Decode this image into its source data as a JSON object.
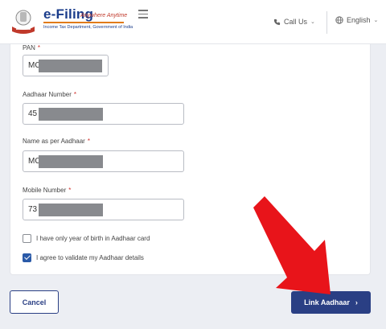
{
  "header": {
    "brand_title": "e-Filing",
    "brand_tagline": "Anywhere Anytime",
    "brand_subtitle": "Income Tax Department, Government of India",
    "call_label": "Call Us",
    "language_label": "English"
  },
  "form": {
    "pan": {
      "label": "PAN",
      "value": "MC"
    },
    "aadhaar": {
      "label": "Aadhaar Number",
      "value": "45"
    },
    "name": {
      "label": "Name as per Aadhaar",
      "value": "MC"
    },
    "mobile": {
      "label": "Mobile Number",
      "value": "73"
    },
    "required_marker": "*",
    "checkbox_year_label": "I have only year of birth in Aadhaar card",
    "checkbox_year_checked": false,
    "checkbox_agree_label": "I agree to validate my Aadhaar details",
    "checkbox_agree_checked": true
  },
  "actions": {
    "cancel_label": "Cancel",
    "primary_label": "Link Aadhaar",
    "primary_chevron": "›"
  },
  "colors": {
    "primary": "#2a3f84",
    "required": "#d0312d",
    "arrow": "#e8141a",
    "brand_accent": "#e07b1a"
  },
  "icons": {
    "emblem": "national-emblem-icon",
    "menu": "hamburger-icon",
    "phone": "phone-icon",
    "globe": "globe-icon",
    "chevron": "chevron-down-icon"
  }
}
